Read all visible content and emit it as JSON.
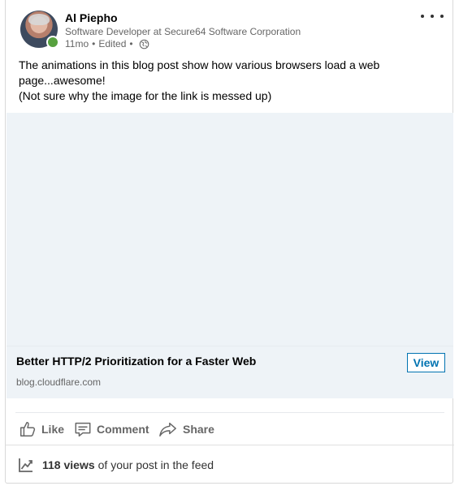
{
  "post": {
    "author": {
      "name": "Al Piepho",
      "headline": "Software Developer at Secure64 Software Corporation",
      "age": "11mo",
      "edited": "Edited",
      "presence_color": "#57a13f",
      "visibility_icon": "globe-icon"
    },
    "more_icon": "ellipsis-icon",
    "text_lines": [
      "The animations in this blog post show how various browsers load a web",
      "page...awesome!",
      "(Not sure why the image for the link is messed up)"
    ],
    "link": {
      "title": "Better HTTP/2 Prioritization for a Faster Web",
      "domain": "blog.cloudflare.com",
      "view_label": "View"
    },
    "actions": {
      "like": "Like",
      "comment": "Comment",
      "share": "Share"
    },
    "views": {
      "count": "118 views",
      "suffix": "of your post in the feed"
    }
  },
  "colors": {
    "accent": "#0073b1",
    "preview_bg": "#eef3f7",
    "secondary_text": "#666666"
  }
}
